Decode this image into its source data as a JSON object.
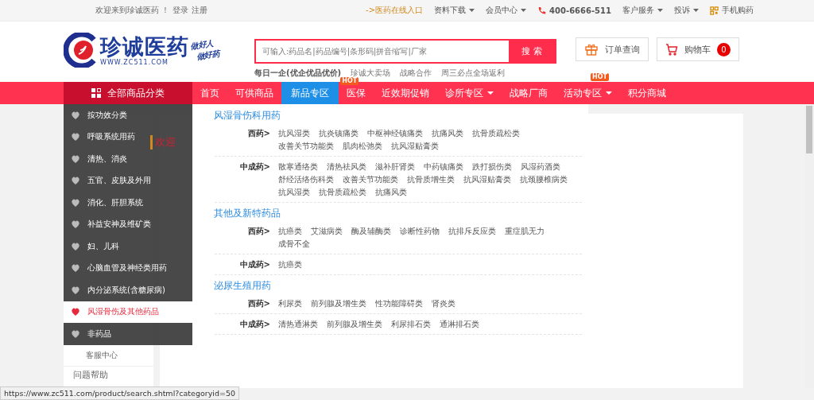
{
  "top_bar": {
    "welcome": "欢迎来到珍诚医药 ！",
    "links": [
      "登录",
      "注册"
    ],
    "right": [
      {
        "label": "->医药在线入口",
        "kind": "highlight"
      },
      {
        "label": "资料下载",
        "kind": "dropdown"
      },
      {
        "label": "会员中心",
        "kind": "dropdown"
      },
      {
        "label": "400-6666-511",
        "kind": "phone"
      },
      {
        "label": "客户服务",
        "kind": "dropdown"
      },
      {
        "label": "投诉",
        "kind": "dropdown"
      },
      {
        "label": "手机购药",
        "kind": "qr"
      }
    ]
  },
  "header": {
    "logo": {
      "name": "珍诚医药",
      "slogan": [
        "做好人",
        "做好药"
      ],
      "url": "WWW.ZC511.COM"
    },
    "search": {
      "placeholder": "可输入:药品名|药品编号|条形码|拼音缩写|厂家",
      "button": "搜 索"
    },
    "hot_links": [
      {
        "label": "每日一企(优企优品优价)",
        "bold": true,
        "badge": "HOT"
      },
      {
        "label": "珍诚大卖场",
        "bold": false
      },
      {
        "label": "战略合作",
        "bold": false
      },
      {
        "label": "周三必点全场返利",
        "bold": false
      }
    ],
    "order_button": "订单查询",
    "cart": {
      "label": "购物车",
      "count": "0"
    }
  },
  "nav": {
    "all_label": "全部商品分类",
    "items": [
      {
        "label": "首页",
        "selected": false,
        "dropdown": false
      },
      {
        "label": "可供商品",
        "selected": false,
        "dropdown": false
      },
      {
        "label": "新品专区",
        "selected": true,
        "dropdown": false
      },
      {
        "label": "医保",
        "selected": false,
        "dropdown": false
      },
      {
        "label": "近效期促销",
        "selected": false,
        "dropdown": false
      },
      {
        "label": "诊所专区",
        "selected": false,
        "dropdown": true
      },
      {
        "label": "战略厂商",
        "selected": false,
        "dropdown": false
      },
      {
        "label": "活动专区",
        "selected": false,
        "dropdown": true,
        "badge": "HOT"
      },
      {
        "label": "积分商城",
        "selected": false,
        "dropdown": false
      }
    ]
  },
  "background_page": {
    "heading": "欢迎",
    "side_links": [
      "客服中心",
      "问题帮助"
    ]
  },
  "categories": [
    {
      "label": "按功效分类",
      "selected": false
    },
    {
      "label": "呼吸系统用药",
      "selected": false
    },
    {
      "label": "清热、消炎",
      "selected": false
    },
    {
      "label": "五官、皮肤及外用",
      "selected": false
    },
    {
      "label": "消化、肝胆系统",
      "selected": false
    },
    {
      "label": "补益安神及维矿类",
      "selected": false
    },
    {
      "label": "妇、儿科",
      "selected": false
    },
    {
      "label": "心脑血管及神经类用药",
      "selected": false
    },
    {
      "label": "内分泌系统(含糖尿病)",
      "selected": false
    },
    {
      "label": "风湿骨伤及其他药品",
      "selected": true
    },
    {
      "label": "非药品",
      "selected": false
    }
  ],
  "flyout": [
    {
      "title": "风湿骨伤科用药",
      "groups": [
        {
          "label": "西药>",
          "items": [
            "抗风湿类",
            "抗炎镇痛类",
            "中枢神经镇痛类",
            "抗痛风类",
            "抗骨质疏松类",
            "改善关节功能类",
            "肌肉松弛类",
            "抗风湿贴膏类"
          ]
        },
        {
          "label": "中成药>",
          "items": [
            "散寒通络类",
            "清热祛风类",
            "滋补肝肾类",
            "中药镇痛类",
            "跌打损伤类",
            "风湿药酒类",
            "舒经活络伤科类",
            "改善关节功能类",
            "抗骨质增生类",
            "抗风湿贴膏类",
            "抗颈腰椎病类",
            "抗风湿类",
            "抗骨质疏松类",
            "抗痛风类"
          ]
        }
      ]
    },
    {
      "title": "其他及新特药品",
      "groups": [
        {
          "label": "西药>",
          "items": [
            "抗癌类",
            "艾滋病类",
            "酶及辅酶类",
            "诊断性药物",
            "抗排斥反应类",
            "重症肌无力",
            "成骨不全"
          ]
        },
        {
          "label": "中成药>",
          "items": [
            "抗癌类"
          ]
        }
      ]
    },
    {
      "title": "泌尿生殖用药",
      "groups": [
        {
          "label": "西药>",
          "items": [
            "利尿类",
            "前列腺及增生类",
            "性功能障碍类",
            "肾炎类"
          ]
        },
        {
          "label": "中成药>",
          "items": [
            "清热通淋类",
            "前列腺及增生类",
            "利尿排石类",
            "通淋排石类"
          ]
        }
      ]
    }
  ],
  "status_bar": {
    "url": "https://www.zc511.com/product/search.shtml?categoryid=50"
  }
}
